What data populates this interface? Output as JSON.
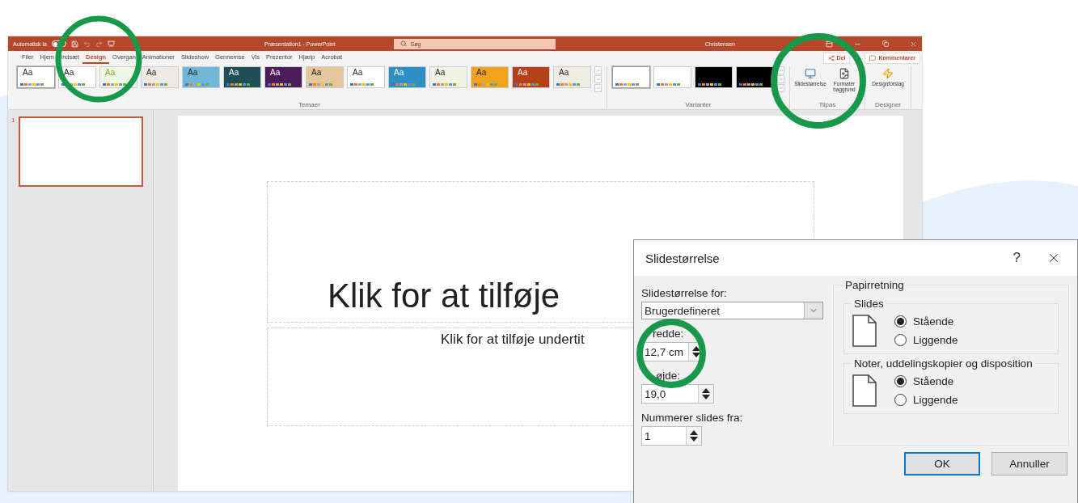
{
  "title_bar": {
    "autosave_label": "Automatisk la",
    "autosave_on": false,
    "title": "Præsentation1  -  PowerPoint",
    "search_placeholder": "Søg",
    "user": "Christensen"
  },
  "ribbon_tabs": [
    {
      "label": "Filer",
      "selected": false
    },
    {
      "label": "Hjem",
      "selected": false
    },
    {
      "label": "Indsæt",
      "selected": false
    },
    {
      "label": "Design",
      "selected": true
    },
    {
      "label": "Overgan",
      "selected": false
    },
    {
      "label": "Animationer",
      "selected": false
    },
    {
      "label": "Slideshow",
      "selected": false
    },
    {
      "label": "Gennemse",
      "selected": false
    },
    {
      "label": "Vis",
      "selected": false
    },
    {
      "label": "Prezentor",
      "selected": false
    },
    {
      "label": "Hjælp",
      "selected": false
    },
    {
      "label": "Acrobat",
      "selected": false
    }
  ],
  "share_buttons": [
    {
      "label": "Del",
      "kind": "share"
    },
    {
      "label": "Kommentarer",
      "kind": "comments"
    }
  ],
  "themes": [
    {
      "label": "Aa",
      "color": "#ffffff",
      "kind": "light",
      "selected": true
    },
    {
      "label": "Aa",
      "color": "#ffffff",
      "kind": "light",
      "selected": false
    },
    {
      "label": "Aa",
      "color": "#eef6e4",
      "kind": "green",
      "selected": false
    },
    {
      "label": "Aa",
      "color": "#efe9e4",
      "kind": "light",
      "selected": false
    },
    {
      "label": "Aa",
      "color": "#6fb7d6",
      "kind": "light",
      "selected": false
    },
    {
      "label": "Aa",
      "color": "#1f4e57",
      "kind": "dark",
      "selected": false
    },
    {
      "label": "Aa",
      "color": "#4b1c58",
      "kind": "dark",
      "selected": false
    },
    {
      "label": "Aa",
      "color": "#e4c79a",
      "kind": "light",
      "selected": false
    },
    {
      "label": "Aa",
      "color": "#ffffff",
      "kind": "light",
      "selected": false
    },
    {
      "label": "Aa",
      "color": "#2e8fc4",
      "kind": "dark",
      "selected": false
    },
    {
      "label": "Aa",
      "color": "#f1f1e4",
      "kind": "light",
      "selected": false
    },
    {
      "label": "Aa",
      "color": "#f2a31c",
      "kind": "light",
      "selected": false
    },
    {
      "label": "Aa",
      "color": "#b5401a",
      "kind": "dark",
      "selected": false
    },
    {
      "label": "Aa",
      "color": "#efece4",
      "kind": "light",
      "selected": false
    }
  ],
  "variants": [
    {
      "color": "#ffffff",
      "selected": true
    },
    {
      "color": "#ffffff",
      "selected": false
    },
    {
      "color": "#000000",
      "selected": false
    },
    {
      "color": "#000000",
      "selected": false
    }
  ],
  "group_labels": {
    "themes": "Temaer",
    "variants": "Varianter",
    "customize": "Tilpas",
    "designer": "Designer"
  },
  "customize_buttons": [
    {
      "label": "Slidestørrelse",
      "kind": "slide-size"
    },
    {
      "label": "Formatér baggrund",
      "kind": "format-background"
    },
    {
      "label": "Designforslag",
      "kind": "design-ideas"
    }
  ],
  "slides": [
    {
      "number": "1",
      "selected": true
    }
  ],
  "slide": {
    "title": "Klik for at tilføje",
    "subtitle": "Klik for at tilføje undertit"
  },
  "dialog": {
    "title": "Slidestørrelse",
    "help": "?",
    "size_label": "Slidestørrelse for:",
    "size_value": "Brugerdefineret",
    "width_label": "redde:",
    "width_value": "12,7 cm",
    "height_label": "øjde:",
    "height_value": "19,0",
    "numbering_label": "Nummerer slides fra:",
    "numbering_value": "1",
    "orientation_title": "Papirretning",
    "orientation_groups": [
      {
        "title": "Slides",
        "options": [
          {
            "label": "Stående",
            "selected": true
          },
          {
            "label": "Liggende",
            "selected": false
          }
        ]
      },
      {
        "title": "Noter, uddelingskopier og disposition",
        "options": [
          {
            "label": "Stående",
            "selected": true
          },
          {
            "label": "Liggende",
            "selected": false
          }
        ]
      }
    ],
    "buttons": [
      {
        "label": "OK",
        "kind": "primary"
      },
      {
        "label": "Annuller",
        "kind": "normal"
      }
    ]
  }
}
